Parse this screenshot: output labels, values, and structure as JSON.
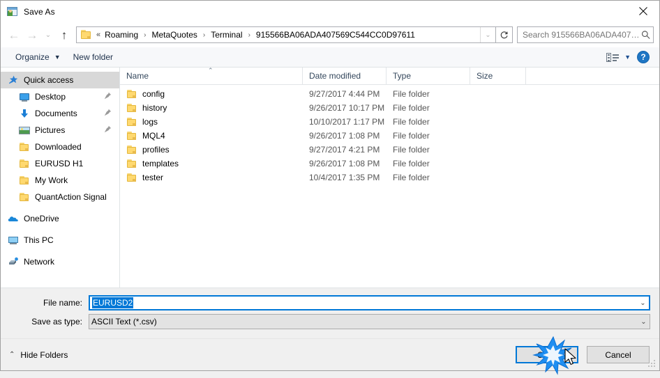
{
  "window": {
    "title": "Save As",
    "app_icon": "metatrader-window-icon",
    "close_label": "✕"
  },
  "nav": {
    "back_label": "←",
    "forward_label": "→",
    "recent_label": "⌄",
    "up_label": "↑",
    "breadcrumb_prefix": "«",
    "breadcrumb": [
      "Roaming",
      "MetaQuotes",
      "Terminal",
      "915566BA06ADA407569C544CC0D97611"
    ],
    "breadcrumb_separator": "›",
    "dropdown_label": "⌄",
    "refresh_label": "↻"
  },
  "search": {
    "placeholder": "Search 915566BA06ADA40756...",
    "icon": "search-icon"
  },
  "toolbar": {
    "organize_label": "Organize",
    "organize_caret": "▼",
    "new_folder_label": "New folder",
    "view_caret": "▼",
    "help_label": "?"
  },
  "sidebar": {
    "items": [
      {
        "label": "Quick access",
        "icon": "star-pin-icon",
        "selected": true,
        "indent": false,
        "pinned": false,
        "group": false
      },
      {
        "label": "Desktop",
        "icon": "desktop-icon",
        "selected": false,
        "indent": true,
        "pinned": true,
        "group": false
      },
      {
        "label": "Documents",
        "icon": "documents-icon",
        "selected": false,
        "indent": true,
        "pinned": true,
        "group": false
      },
      {
        "label": "Pictures",
        "icon": "pictures-icon",
        "selected": false,
        "indent": true,
        "pinned": true,
        "group": false
      },
      {
        "label": "Downloaded",
        "icon": "folder-icon",
        "selected": false,
        "indent": true,
        "pinned": false,
        "group": false
      },
      {
        "label": "EURUSD H1",
        "icon": "folder-icon",
        "selected": false,
        "indent": true,
        "pinned": false,
        "group": false
      },
      {
        "label": "My Work",
        "icon": "folder-icon",
        "selected": false,
        "indent": true,
        "pinned": false,
        "group": false
      },
      {
        "label": "QuantAction Signal",
        "icon": "folder-icon",
        "selected": false,
        "indent": true,
        "pinned": false,
        "group": false
      },
      {
        "label": "OneDrive",
        "icon": "onedrive-icon",
        "selected": false,
        "indent": false,
        "pinned": false,
        "group": true
      },
      {
        "label": "This PC",
        "icon": "this-pc-icon",
        "selected": false,
        "indent": false,
        "pinned": false,
        "group": true
      },
      {
        "label": "Network",
        "icon": "network-icon",
        "selected": false,
        "indent": false,
        "pinned": false,
        "group": true
      }
    ],
    "pin_glyph": "📌"
  },
  "filelist": {
    "columns": [
      "Name",
      "Date modified",
      "Type",
      "Size"
    ],
    "sort_caret": "⌃",
    "rows": [
      {
        "name": "config",
        "date": "9/27/2017 4:44 PM",
        "type": "File folder",
        "size": ""
      },
      {
        "name": "history",
        "date": "9/26/2017 10:17 PM",
        "type": "File folder",
        "size": ""
      },
      {
        "name": "logs",
        "date": "10/10/2017 1:17 PM",
        "type": "File folder",
        "size": ""
      },
      {
        "name": "MQL4",
        "date": "9/26/2017 1:08 PM",
        "type": "File folder",
        "size": ""
      },
      {
        "name": "profiles",
        "date": "9/27/2017 4:21 PM",
        "type": "File folder",
        "size": ""
      },
      {
        "name": "templates",
        "date": "9/26/2017 1:08 PM",
        "type": "File folder",
        "size": ""
      },
      {
        "name": "tester",
        "date": "10/4/2017 1:35 PM",
        "type": "File folder",
        "size": ""
      }
    ]
  },
  "form": {
    "filename_label": "File name:",
    "filename_value": "EURUSD2",
    "filetype_label": "Save as type:",
    "filetype_value": "ASCII Text (*.csv)",
    "combo_caret": "⌄"
  },
  "footer": {
    "hide_folders_label": "Hide Folders",
    "hide_folders_caret": "⌃",
    "save_label": "Save",
    "cancel_label": "Cancel"
  },
  "colors": {
    "accent": "#0078d7",
    "selection": "#d8d8d8",
    "folder": "#ffd970",
    "help_blue": "#1f76c4",
    "header_text": "#34475c"
  }
}
